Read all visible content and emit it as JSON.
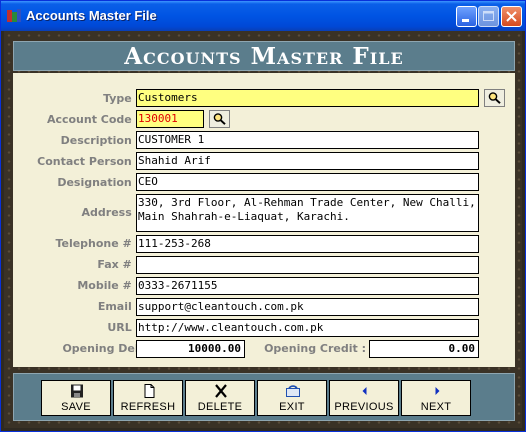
{
  "window": {
    "title": "Accounts Master File"
  },
  "header": {
    "title": "Accounts Master File"
  },
  "form": {
    "type": {
      "label": "Type :",
      "value": "Customers"
    },
    "account_code": {
      "label": "Account Code :",
      "value": "130001"
    },
    "description": {
      "label": "Description :",
      "value": "CUSTOMER 1"
    },
    "contact_person": {
      "label": "Contact Person :",
      "value": "Shahid Arif"
    },
    "designation": {
      "label": "Designation :",
      "value": "CEO"
    },
    "address": {
      "label": "Address :",
      "value": "330, 3rd Floor, Al-Rehman Trade Center, New Challi, Main Shahrah-e-Liaquat, Karachi."
    },
    "telephone": {
      "label": "Telephone # :",
      "value": "111-253-268"
    },
    "fax": {
      "label": "Fax # :",
      "value": ""
    },
    "mobile": {
      "label": "Mobile # :",
      "value": "0333-2671155"
    },
    "email": {
      "label": "Email :",
      "value": "support@cleantouch.com.pk"
    },
    "url": {
      "label": "URL :",
      "value": "http://www.cleantouch.com.pk"
    },
    "opening_debit": {
      "label": "Opening Debit :",
      "value": "10000.00"
    },
    "opening_credit": {
      "label": "Opening Credit :",
      "value": "0.00"
    }
  },
  "toolbar": {
    "save": {
      "label": "Save",
      "icon": "floppy-disk-icon"
    },
    "refresh": {
      "label": "Refresh",
      "icon": "page-icon"
    },
    "delete": {
      "label": "Delete",
      "icon": "x-icon"
    },
    "exit": {
      "label": "Exit",
      "icon": "exit-icon"
    },
    "previous": {
      "label": "Previous",
      "icon": "triangle-left-icon"
    },
    "next": {
      "label": "Next",
      "icon": "triangle-right-icon"
    }
  },
  "colors": {
    "title_bar": "#0054e3",
    "banner": "#5b7d8c",
    "panel": "#f3f0d8",
    "highlight_field": "#ffff80",
    "code_text": "#e00000"
  }
}
